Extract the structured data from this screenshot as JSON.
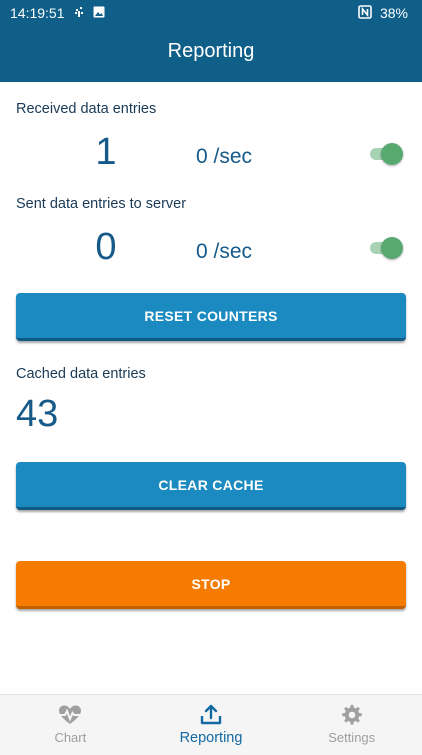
{
  "status_bar": {
    "time": "14:19:51",
    "left_icons": [
      "usb-debug-icon",
      "image-icon"
    ],
    "right_icons": [
      "nfc-icon"
    ],
    "battery": "38%"
  },
  "app_bar": {
    "title": "Reporting",
    "color": "#0f5f88"
  },
  "received": {
    "label": "Received data entries",
    "count": "1",
    "rate": "0 /sec",
    "toggle_on": true
  },
  "sent": {
    "label": "Sent data entries to server",
    "count": "0",
    "rate": "0 /sec",
    "toggle_on": true
  },
  "reset_button": {
    "label": "RESET COUNTERS",
    "color": "#1b8ac0"
  },
  "cached": {
    "label": "Cached data entries",
    "count": "43"
  },
  "clear_button": {
    "label": "CLEAR CACHE",
    "color": "#1b8ac0"
  },
  "stop_button": {
    "label": "STOP",
    "color": "#f57c00"
  },
  "bottom_nav": {
    "items": [
      {
        "label": "Chart",
        "icon": "heart-pulse-icon",
        "active": false
      },
      {
        "label": "Reporting",
        "icon": "upload-icon",
        "active": true
      },
      {
        "label": "Settings",
        "icon": "gear-icon",
        "active": false
      }
    ],
    "active_color": "#1369a3"
  }
}
